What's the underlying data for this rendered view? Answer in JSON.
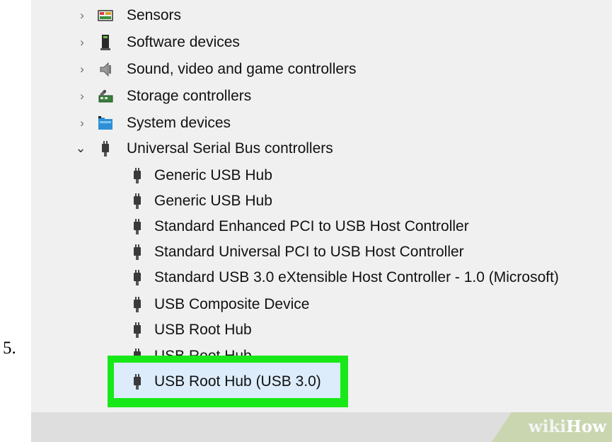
{
  "step_number": "5.",
  "tree": {
    "categories": [
      {
        "label": "Sensors",
        "icon": "sensors-icon"
      },
      {
        "label": "Software devices",
        "icon": "software-device-icon"
      },
      {
        "label": "Sound, video and game controllers",
        "icon": "speaker-icon"
      },
      {
        "label": "Storage controllers",
        "icon": "storage-controller-icon"
      },
      {
        "label": "System devices",
        "icon": "system-folder-icon"
      },
      {
        "label": "Universal Serial Bus controllers",
        "icon": "usb-plug-icon"
      }
    ],
    "usb_children": [
      {
        "label": "Generic USB Hub"
      },
      {
        "label": "Generic USB Hub"
      },
      {
        "label": "Standard Enhanced PCI to USB Host Controller"
      },
      {
        "label": "Standard Universal PCI to USB Host Controller"
      },
      {
        "label": "Standard USB 3.0 eXtensible Host Controller - 1.0 (Microsoft)"
      },
      {
        "label": "USB Composite Device"
      },
      {
        "label": "USB Root Hub"
      },
      {
        "label": "USB Root Hub"
      }
    ],
    "selected": {
      "label": "USB Root Hub (USB 3.0)"
    }
  },
  "colors": {
    "highlight_border": "#18e818",
    "selection_bg": "#dcecfb",
    "window_bg": "#f0f0f0"
  },
  "watermark": {
    "wiki": "wiki",
    "how": "How"
  }
}
